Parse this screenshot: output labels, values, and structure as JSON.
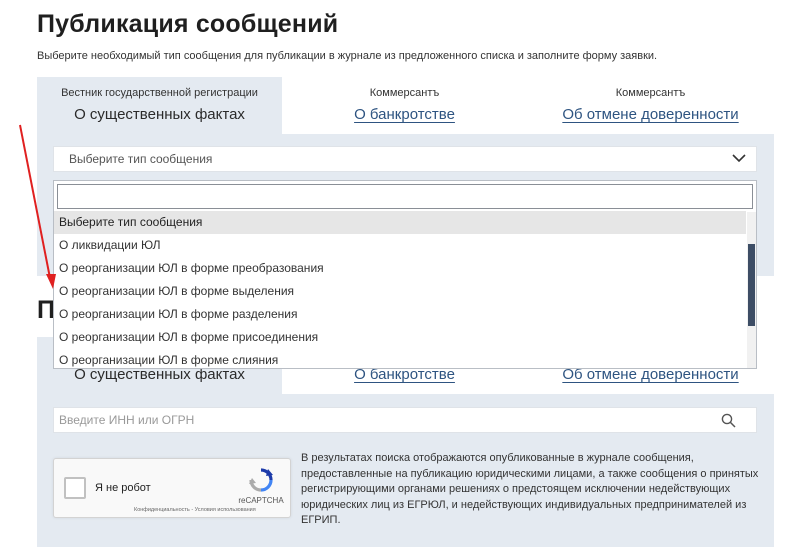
{
  "page": {
    "title": "Публикация сообщений",
    "subtitle": "Выберите необходимый тип сообщения для публикации в журнале из предложенного списка и заполните форму заявки."
  },
  "tabs": [
    {
      "small": "Вестник государственной регистрации",
      "label": "О существенных фактах",
      "active": true
    },
    {
      "small": "Коммерсантъ",
      "label": "О банкротстве",
      "active": false
    },
    {
      "small": "Коммерсантъ",
      "label": "Об отмене доверенности",
      "active": false
    }
  ],
  "type_select": {
    "placeholder": "Выберите тип сообщения",
    "icon": "chevron-down-icon"
  },
  "dropdown": {
    "search_value": "",
    "items": [
      "Выберите тип сообщения",
      "О ликвидации ЮЛ",
      "О реорганизации ЮЛ в форме преобразования",
      "О реорганизации ЮЛ в форме выделения",
      "О реорганизации ЮЛ в форме разделения",
      "О реорганизации ЮЛ в форме присоединения",
      "О реорганизации ЮЛ в форме слияния"
    ],
    "selected_index": 0
  },
  "section2": {
    "title_fragment": "П",
    "tabs": [
      {
        "label": "О существенных фактах",
        "active": true
      },
      {
        "label": "О банкротстве",
        "active": false
      },
      {
        "label": "Об отмене доверенности",
        "active": false
      }
    ],
    "search_placeholder": "Введите ИНН или ОГРН",
    "search_icon": "search-icon"
  },
  "captcha": {
    "label": "Я не робот",
    "brand": "reCAPTCHA",
    "links": "Конфиденциальность - Условия использования"
  },
  "info_text": "В результатах поиска отображаются опубликованные в журнале сообщения, предоставленные на публикацию юридическими лицами, а также сообщения о принятых регистрирующими органами решениях о предстоящем исключении недействующих юридических лиц из ЕГРЮЛ, и недействующих индивидуальных предпринимателей из ЕГРИП.",
  "colors": {
    "panel": "#e4eaf1",
    "link": "#2e5481",
    "arrow": "#e02020",
    "scroll_thumb": "#3d4d65"
  }
}
